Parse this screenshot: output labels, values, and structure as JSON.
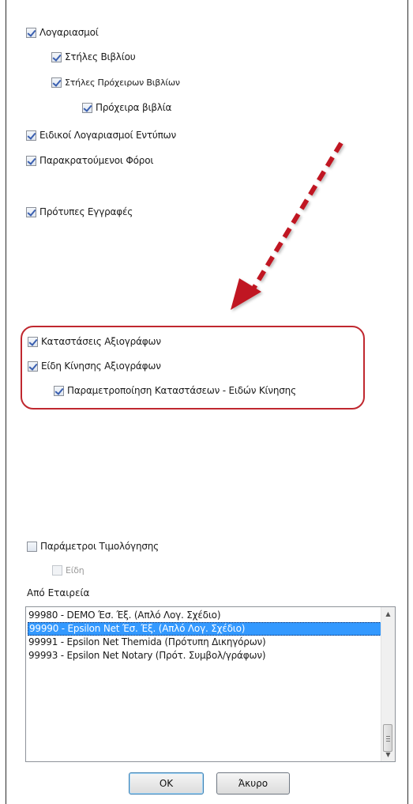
{
  "tree": {
    "accounts": "Λογαριασμοί",
    "book_columns": "Στήλες Βιβλίου",
    "draft_book_columns": "Στήλες Πρόχειρων Βιβλίων",
    "draft_books": "Πρόχειρα βιβλία",
    "special_form_accounts": "Ειδικοί Λογαριασμοί Εντύπων",
    "withheld_taxes": "Παρακρατούμενοι Φόροι",
    "template_entries": "Πρότυπες Εγγραφές",
    "securities_statuses": "Καταστάσεις Αξιογράφων",
    "securities_movement_types": "Είδη Κίνησης Αξιογράφων",
    "statuses_movement_params": "Παραμετροποίηση Καταστάσεων - Ειδών Κίνησης",
    "billing_params": "Παράμετροι Τιμολόγησης",
    "items": "Είδη"
  },
  "company": {
    "label": "Από Εταιρεία",
    "options": [
      "99980 - DEMO Έσ. Έξ. (Απλό Λογ. Σχέδιο)",
      "99990 - Epsilon Net Έσ. Έξ. (Απλό Λογ. Σχέδιο)",
      "99991 - Epsilon Net Themida (Πρότυπη Δικηγόρων)",
      "99993 - Epsilon Net Notary (Πρότ. Συμβολ/γράφων)"
    ],
    "selected": "99990 - Epsilon Net Έσ. Έξ. (Απλό Λογ. Σχέδιο)"
  },
  "buttons": {
    "ok": "OK",
    "cancel": "Άκυρο"
  },
  "colors": {
    "highlight": "#c0282f",
    "selection": "#3399ff",
    "checkmark": "#3a5fb0"
  }
}
